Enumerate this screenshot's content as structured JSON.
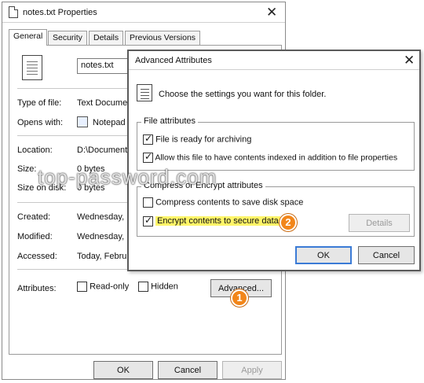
{
  "properties_window": {
    "title": "notes.txt Properties",
    "tabs": [
      "General",
      "Security",
      "Details",
      "Previous Versions"
    ],
    "file_name": "notes.txt",
    "fields": [
      {
        "label": "Type of file:",
        "value": "Text Document"
      },
      {
        "label": "Opens with:",
        "value": "Notepad"
      },
      {
        "label": "Location:",
        "value": "D:\\Documents"
      },
      {
        "label": "Size:",
        "value": "0 bytes"
      },
      {
        "label": "Size on disk:",
        "value": "0 bytes"
      },
      {
        "label": "Created:",
        "value": "Wednesday, ..."
      },
      {
        "label": "Modified:",
        "value": "Wednesday, ..."
      },
      {
        "label": "Accessed:",
        "value": "Today, Febru..."
      }
    ],
    "attributes_label": "Attributes:",
    "read_only_label": "Read-only",
    "hidden_label": "Hidden",
    "advanced_button": "Advanced...",
    "ok_button": "OK",
    "cancel_button": "Cancel",
    "apply_button": "Apply"
  },
  "advanced_dialog": {
    "title": "Advanced Attributes",
    "intro": "Choose the settings you want for this folder.",
    "file_attributes_group": "File attributes",
    "archive_label": "File is ready for archiving",
    "index_label": "Allow this file to have contents indexed in addition to file properties",
    "compress_group": "Compress or Encrypt attributes",
    "compress_label": "Compress contents to save disk space",
    "encrypt_label": "Encrypt contents to secure data",
    "details_button": "Details",
    "ok_button": "OK",
    "cancel_button": "Cancel"
  },
  "markers": [
    "1",
    "2"
  ],
  "watermark": "top-password.com",
  "colors": {
    "highlight": "#fff568",
    "marker": "#f2861a",
    "focus_border": "#3b7bd6"
  }
}
